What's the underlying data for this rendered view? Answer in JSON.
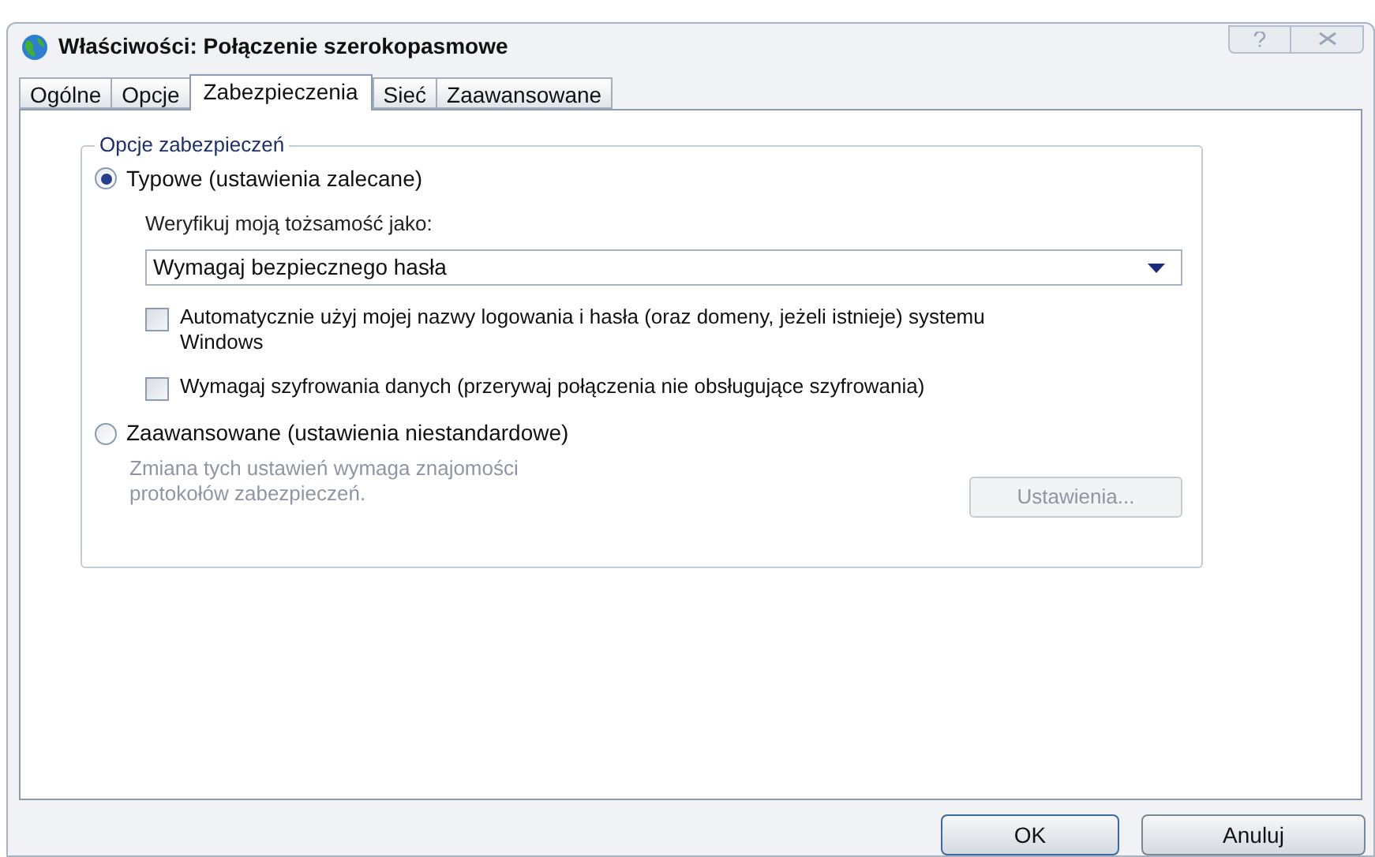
{
  "window": {
    "title": "Właściwości: Połączenie szerokopasmowe"
  },
  "tabs": [
    {
      "label": "Ogólne",
      "selected": false
    },
    {
      "label": "Opcje",
      "selected": false
    },
    {
      "label": "Zabezpieczenia",
      "selected": true
    },
    {
      "label": "Sieć",
      "selected": false
    },
    {
      "label": "Zaawansowane",
      "selected": false
    }
  ],
  "group": {
    "title": "Opcje zabezpieczeń",
    "typical": {
      "label": "Typowe (ustawienia zalecane)",
      "selected": true,
      "verify_label": "Weryfikuj moją tożsamość jako:",
      "dropdown": {
        "value": "Wymagaj bezpiecznego hasła"
      },
      "checkboxes": [
        {
          "label": "Automatycznie użyj mojej nazwy logowania i hasła (oraz domeny, jeżeli istnieje) systemu Windows",
          "checked": false
        },
        {
          "label": "Wymagaj szyfrowania danych (przerywaj połączenia nie obsługujące szyfrowania)",
          "checked": false
        }
      ]
    },
    "advanced": {
      "label": "Zaawansowane (ustawienia niestandardowe)",
      "selected": false,
      "description": "Zmiana tych ustawień wymaga znajomości protokołów zabezpieczeń.",
      "settings_button": {
        "label": "Ustawienia...",
        "disabled": true
      }
    }
  },
  "buttons": [
    {
      "label": "OK"
    },
    {
      "label": "Anuluj"
    }
  ]
}
